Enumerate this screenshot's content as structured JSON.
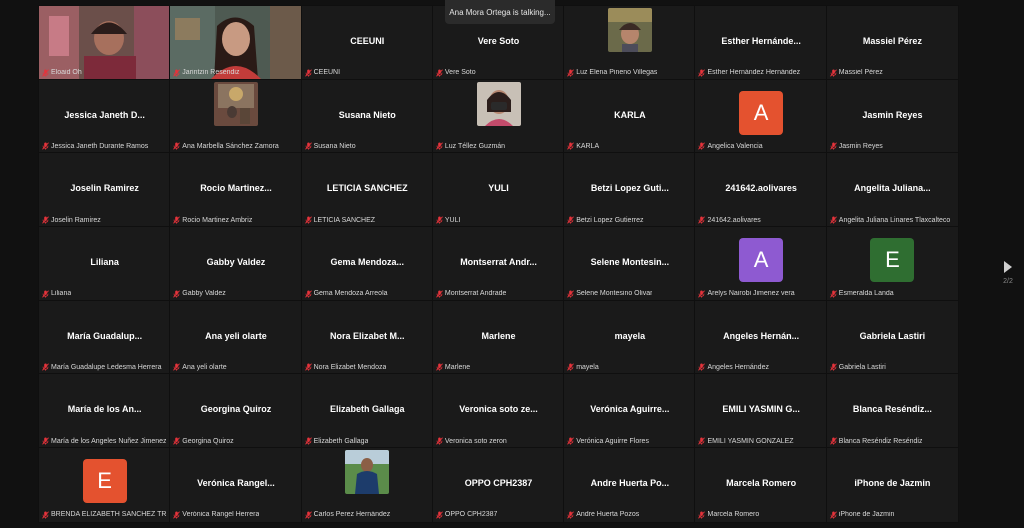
{
  "toast": "Ana  Mora Ortega is talking...",
  "page_indicator": "2/2",
  "colors": {
    "avatar_orange": "#e4522f",
    "avatar_purple": "#8e5ad1",
    "avatar_green": "#2f6e31",
    "muted_red": "#e5333b"
  },
  "tiles": [
    {
      "label": "Eloaid Oh",
      "big": "",
      "kind": "video",
      "video_variant": "v1"
    },
    {
      "label": "Jarintzin  Resendiz",
      "big": "",
      "kind": "video",
      "video_variant": "v2"
    },
    {
      "label": "CEEUNI",
      "big": "CEEUNI",
      "kind": "text"
    },
    {
      "label": "Vere Soto",
      "big": "Vere Soto",
      "kind": "text"
    },
    {
      "label": "Luz Elena Pineno Villegas",
      "big": "",
      "kind": "photo",
      "photo_variant": "p1"
    },
    {
      "label": "Esther Hernández Hernández",
      "big": "Esther  Hernánde...",
      "kind": "text"
    },
    {
      "label": "Massiel Pérez",
      "big": "Massiel Pérez",
      "kind": "text"
    },
    {
      "label": "Jessica Janeth Durante Ramos",
      "big": "Jessica Janeth D...",
      "kind": "text"
    },
    {
      "label": "Ana Marbella Sánchez Zamora",
      "big": "",
      "kind": "photo",
      "photo_variant": "p2"
    },
    {
      "label": "Susana Nieto",
      "big": "Susana Nieto",
      "kind": "text"
    },
    {
      "label": "Luz Téllez Guzmán",
      "big": "",
      "kind": "photo",
      "photo_variant": "p3"
    },
    {
      "label": "KARLA",
      "big": "KARLA",
      "kind": "text"
    },
    {
      "label": "Angelica Valencia",
      "big": "",
      "kind": "avatar",
      "letter": "A",
      "color": "#e4522f"
    },
    {
      "label": "Jasmin Reyes",
      "big": "Jasmin Reyes",
      "kind": "text"
    },
    {
      "label": "Joselin Ramirez",
      "big": "Joselin Ramirez",
      "kind": "text"
    },
    {
      "label": "Rocio Martinez Ambriz",
      "big": "Rocio  Martinez...",
      "kind": "text"
    },
    {
      "label": "LETICIA SANCHEZ",
      "big": "LETICIA SANCHEZ",
      "kind": "text"
    },
    {
      "label": "YULI",
      "big": "YULI",
      "kind": "text"
    },
    {
      "label": "Betzi Lopez Gutierrez",
      "big": "Betzi Lopez Guti...",
      "kind": "text"
    },
    {
      "label": "241642.aolivares",
      "big": "241642.aolivares",
      "kind": "text"
    },
    {
      "label": "Angelita Juliana Linares Tlaxcalteco",
      "big": "Angelita  Juliana...",
      "kind": "text"
    },
    {
      "label": "Liliana",
      "big": "Liliana",
      "kind": "text"
    },
    {
      "label": "Gabby Valdez",
      "big": "Gabby Valdez",
      "kind": "text"
    },
    {
      "label": "Gema Mendoza Arreola",
      "big": "Gema  Mendoza...",
      "kind": "text"
    },
    {
      "label": "Montserrat Andrade",
      "big": "Montserrat  Andr...",
      "kind": "text"
    },
    {
      "label": "Selene Montesino Olivar",
      "big": "Selene  Montesin...",
      "kind": "text"
    },
    {
      "label": "Arelys Nairobi Jimenez vera",
      "big": "",
      "kind": "avatar",
      "letter": "A",
      "color": "#8e5ad1"
    },
    {
      "label": "Esmeralda Landa",
      "big": "",
      "kind": "avatar",
      "letter": "E",
      "color": "#2f6e31"
    },
    {
      "label": "María Guadalupe Ledesma Herrera",
      "big": "María  Guadalup...",
      "kind": "text"
    },
    {
      "label": "Ana yeli olarte",
      "big": "Ana yeli olarte",
      "kind": "text"
    },
    {
      "label": "Nora Elizabet Mendoza",
      "big": "Nora Elizabet M...",
      "kind": "text"
    },
    {
      "label": "Marlene",
      "big": "Marlene",
      "kind": "text"
    },
    {
      "label": "mayela",
      "big": "mayela",
      "kind": "text"
    },
    {
      "label": "Angeles Hernández",
      "big": "Angeles  Hernán...",
      "kind": "text"
    },
    {
      "label": "Gabriela Lastiri",
      "big": "Gabriela Lastiri",
      "kind": "text"
    },
    {
      "label": "María de los Angeles Nuñez Jimenez",
      "big": "María de los An...",
      "kind": "text"
    },
    {
      "label": "Georgina Quiroz",
      "big": "Georgina Quiroz",
      "kind": "text"
    },
    {
      "label": "Elizabeth Gallaga",
      "big": "Elizabeth Gallaga",
      "kind": "text"
    },
    {
      "label": "Veronica soto zeron",
      "big": "Veronica soto ze...",
      "kind": "text"
    },
    {
      "label": "Verónica Aguirre Flores",
      "big": "Verónica  Aguirre...",
      "kind": "text"
    },
    {
      "label": "EMILI YASMIN GONZALEZ",
      "big": "EMILI  YASMIN  G...",
      "kind": "text"
    },
    {
      "label": "Blanca Reséndiz Reséndiz",
      "big": "Blanca  Reséndiz...",
      "kind": "text"
    },
    {
      "label": "BRENDA ELIZABETH SANCHEZ TRU...",
      "big": "",
      "kind": "avatar",
      "letter": "E",
      "color": "#e4522f"
    },
    {
      "label": "Verónica Rangel Herrera",
      "big": "Verónica  Rangel...",
      "kind": "text"
    },
    {
      "label": "Carlos Perez Hernández",
      "big": "",
      "kind": "photo",
      "photo_variant": "p4"
    },
    {
      "label": "OPPO CPH2387",
      "big": "OPPO CPH2387",
      "kind": "text"
    },
    {
      "label": "Andre Huerta Pozos",
      "big": "Andre Huerta Po...",
      "kind": "text"
    },
    {
      "label": "Marcela Romero",
      "big": "Marcela Romero",
      "kind": "text"
    },
    {
      "label": "iPhone de Jazmin",
      "big": "iPhone de Jazmin",
      "kind": "text"
    }
  ]
}
